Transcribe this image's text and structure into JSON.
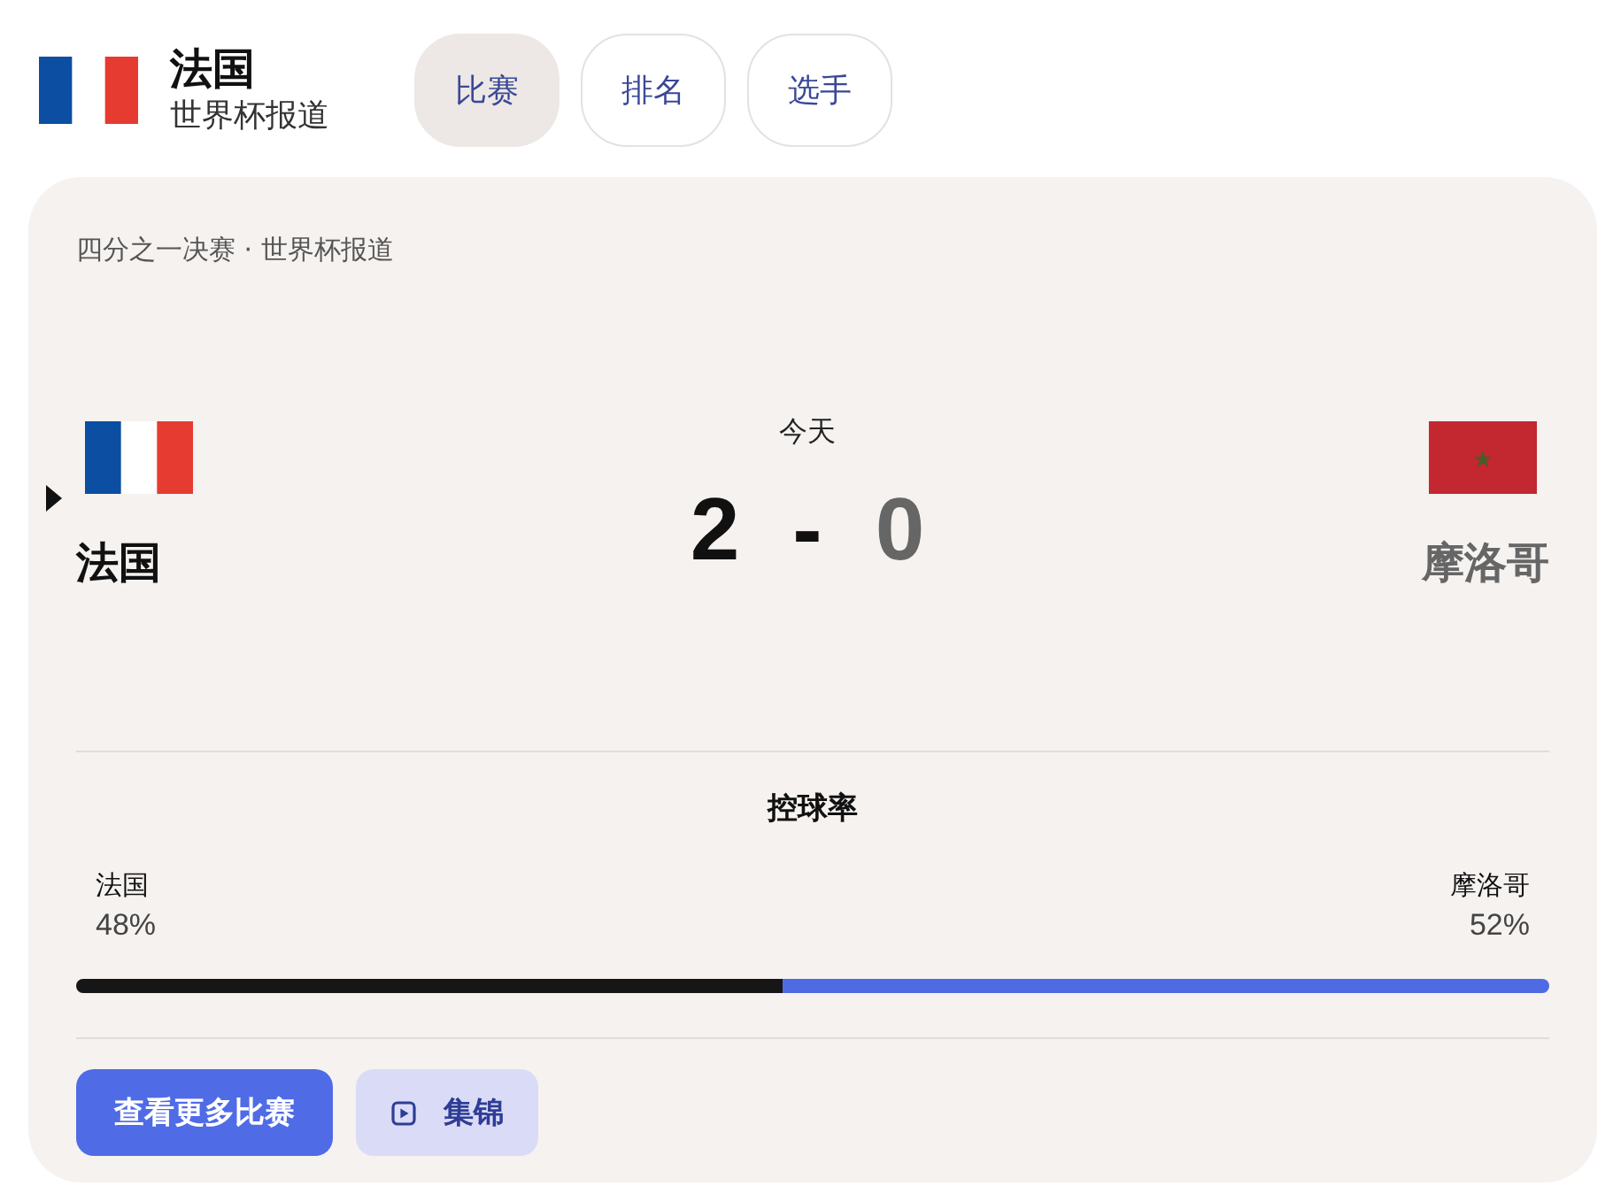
{
  "header": {
    "title": "法国",
    "subtitle": "世界杯报道"
  },
  "tabs": [
    {
      "label": "比赛",
      "selected": true
    },
    {
      "label": "排名",
      "selected": false
    },
    {
      "label": "选手",
      "selected": false
    }
  ],
  "match": {
    "breadcrumb": "四分之一决赛 · 世界杯报道",
    "date": "今天",
    "separator": "-",
    "teams": [
      {
        "name": "法国",
        "score": "2",
        "winner": true
      },
      {
        "name": "摩洛哥",
        "score": "0",
        "winner": false
      }
    ]
  },
  "possession": {
    "title": "控球率",
    "teams": [
      {
        "name": "法国",
        "value": "48%",
        "level": 0.48,
        "color": "#161616"
      },
      {
        "name": "摩洛哥",
        "value": "52%",
        "level": 0.52,
        "color": "#4f6be3"
      }
    ]
  },
  "buttons": [
    {
      "label": "查看更多比赛",
      "kind": "primary"
    },
    {
      "label": "集锦",
      "kind": "secondary"
    }
  ]
}
